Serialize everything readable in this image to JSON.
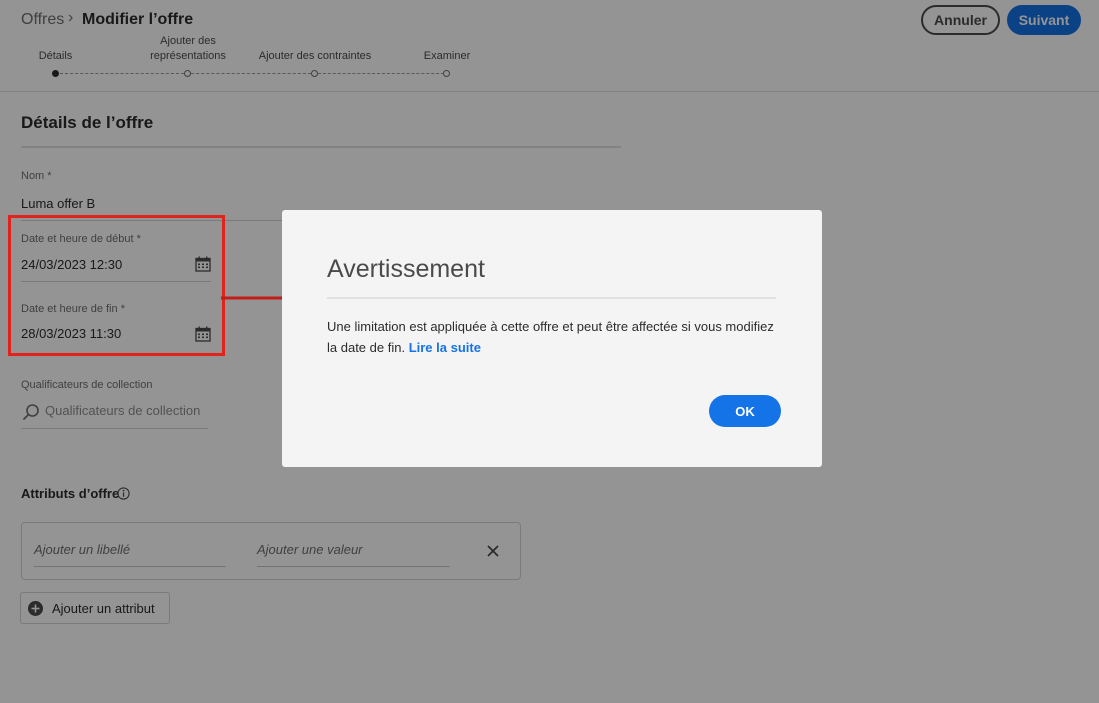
{
  "breadcrumb": {
    "root": "Offres",
    "separator": "›",
    "current": "Modifier l’offre"
  },
  "actions": {
    "cancel_label": "Annuler",
    "next_label": "Suivant"
  },
  "steps": [
    {
      "label": "Détails",
      "active": true
    },
    {
      "label": "Ajouter des représentations",
      "active": false
    },
    {
      "label": "Ajouter des contraintes",
      "active": false
    },
    {
      "label": "Examiner",
      "active": false
    }
  ],
  "details": {
    "title": "Détails de l’offre",
    "name_label": "Nom",
    "name_value": "Luma offer B",
    "start_label": "Date et heure de début",
    "start_value": "24/03/2023 12:30",
    "end_label": "Date et heure de fin",
    "end_value": "28/03/2023 11:30",
    "required_marker": "*",
    "qualifiers_label": "Qualificateurs de collection",
    "qualifiers_placeholder": "Qualificateurs de collection"
  },
  "attributes": {
    "title": "Attributs d’offre",
    "label_placeholder": "Ajouter un libellé",
    "value_placeholder": "Ajouter une valeur",
    "add_button": "Ajouter un attribut"
  },
  "dialog": {
    "title": "Avertissement",
    "body": "Une limitation est appliquée à cette offre et peut être affectée si vous modifiez la date de fin.",
    "link": "Lire la suite",
    "ok_label": "OK"
  },
  "colors": {
    "accent": "#1473e6",
    "annotation": "#e0231c",
    "overlay": "rgba(0,0,0,0.42)"
  },
  "icons": [
    "calendar-icon",
    "search-icon",
    "info-icon",
    "close-icon",
    "add-circle-icon",
    "annotation-arrow"
  ]
}
